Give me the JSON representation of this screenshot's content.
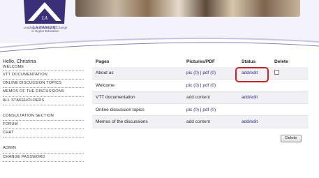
{
  "brand": {
    "logo_text": "LA NANCHE",
    "tagline_lines": [
      "Leading and Managing Change",
      "in Higher Education"
    ]
  },
  "sidebar": {
    "greeting": "Hello, Christina",
    "items": [
      {
        "label": "Welcome"
      },
      {
        "label": "VTT documentation"
      },
      {
        "label": "Online discussion topics"
      },
      {
        "label": "Memos of the discussions"
      },
      {
        "label": "All stakeholders"
      },
      {
        "label": "Consultation section"
      },
      {
        "label": "Forum"
      },
      {
        "label": "Chat"
      },
      {
        "label": "Admin"
      },
      {
        "label": "Change password"
      }
    ]
  },
  "table": {
    "headers": {
      "pages": "Pages",
      "pictures": "Pictures/PDF",
      "status": "Status",
      "delete": "Delete"
    },
    "rows": [
      {
        "page": "About us",
        "pictures": "pic (0) | pdf (0)",
        "status": "add/edit",
        "has_delete": true
      },
      {
        "page": "Welcome",
        "pictures": "pic (0) | pdf (0)",
        "status": "",
        "has_delete": false
      },
      {
        "page": "VTT documentation",
        "pictures": "add content",
        "status": "add/edit",
        "has_delete": false
      },
      {
        "page": "Online discussion topics",
        "pictures": "pic (0) | pdf (0)",
        "status": "",
        "has_delete": false
      },
      {
        "page": "Memos of the discussions",
        "pictures": "add content",
        "status": "add/edit",
        "has_delete": false
      }
    ],
    "delete_button": "Delete"
  },
  "colors": {
    "brand_purple": "#3b2f7a",
    "header_bg": "#f4f3fb",
    "highlight_red": "#d42020",
    "link_blue": "#2a2a8a"
  }
}
